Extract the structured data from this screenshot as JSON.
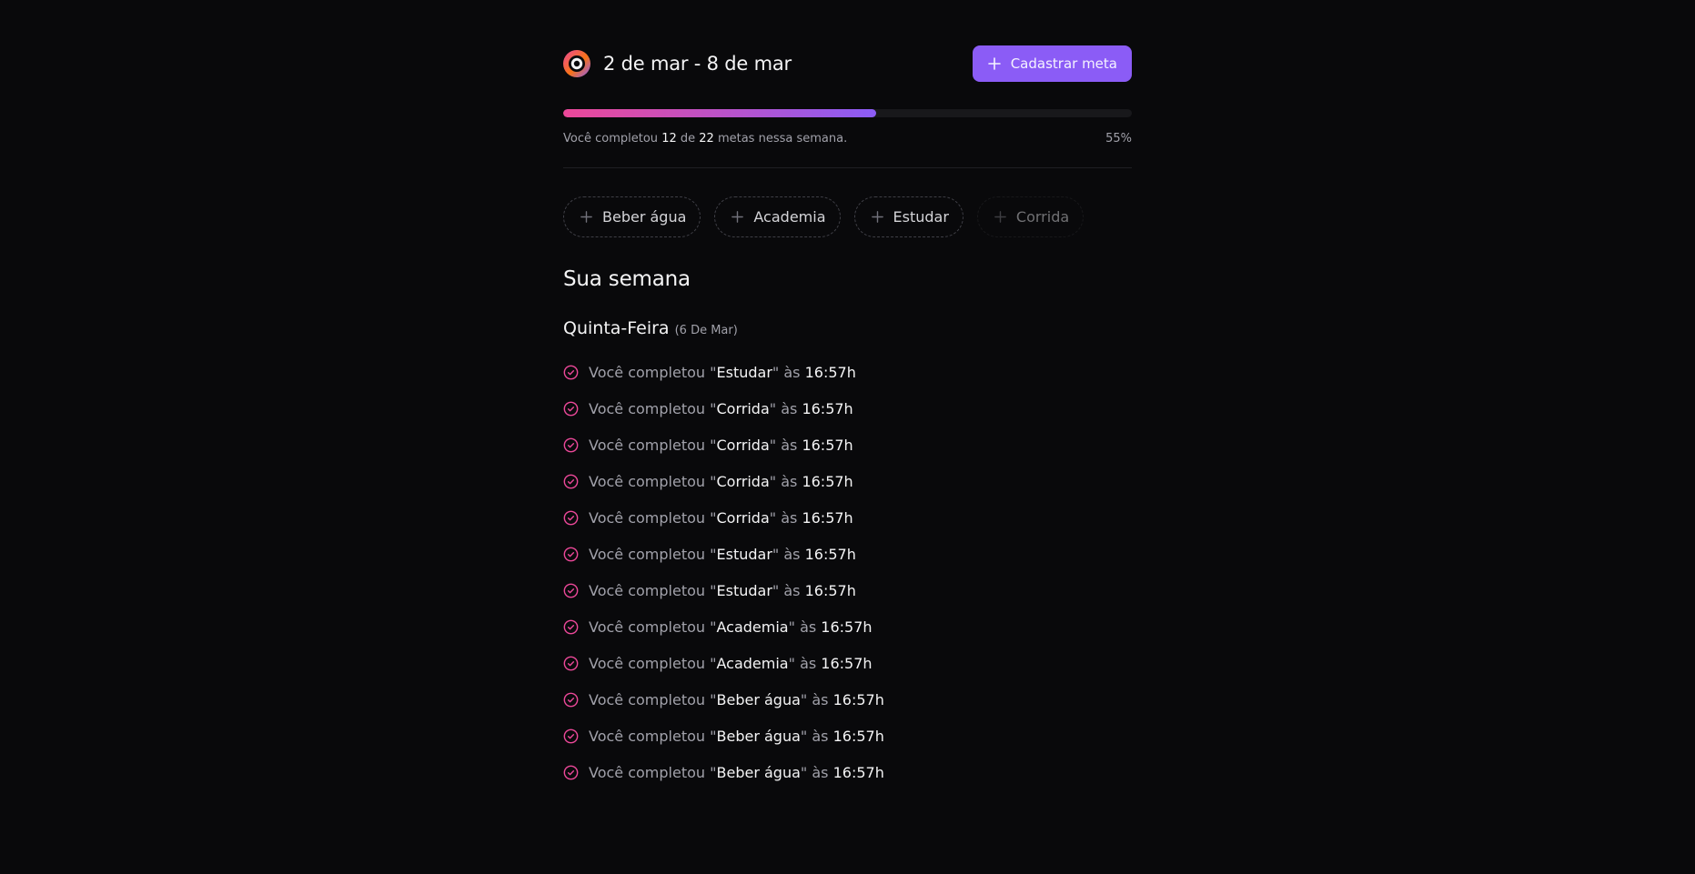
{
  "header": {
    "week_range": "2 de mar - 8 de mar",
    "create_button_label": "Cadastrar meta"
  },
  "progress": {
    "percent": 55,
    "completed": "12",
    "total": "22",
    "text_prefix": "Você completou",
    "text_middle": "de",
    "text_suffix": "metas nessa semana.",
    "percent_label": "55%"
  },
  "pending_goals": [
    {
      "label": "Beber água",
      "disabled": false
    },
    {
      "label": "Academia",
      "disabled": false
    },
    {
      "label": "Estudar",
      "disabled": false
    },
    {
      "label": "Corrida",
      "disabled": true
    }
  ],
  "summary": {
    "title": "Sua semana",
    "days": [
      {
        "weekday": "Quinta-Feira",
        "date": "(6 De Mar)",
        "completions": [
          {
            "prefix": "Você completou",
            "goal": "Estudar",
            "at": "às",
            "time": "16:57h"
          },
          {
            "prefix": "Você completou",
            "goal": "Corrida",
            "at": "às",
            "time": "16:57h"
          },
          {
            "prefix": "Você completou",
            "goal": "Corrida",
            "at": "às",
            "time": "16:57h"
          },
          {
            "prefix": "Você completou",
            "goal": "Corrida",
            "at": "às",
            "time": "16:57h"
          },
          {
            "prefix": "Você completou",
            "goal": "Corrida",
            "at": "às",
            "time": "16:57h"
          },
          {
            "prefix": "Você completou",
            "goal": "Estudar",
            "at": "às",
            "time": "16:57h"
          },
          {
            "prefix": "Você completou",
            "goal": "Estudar",
            "at": "às",
            "time": "16:57h"
          },
          {
            "prefix": "Você completou",
            "goal": "Academia",
            "at": "às",
            "time": "16:57h"
          },
          {
            "prefix": "Você completou",
            "goal": "Academia",
            "at": "às",
            "time": "16:57h"
          },
          {
            "prefix": "Você completou",
            "goal": "Beber água",
            "at": "às",
            "time": "16:57h"
          },
          {
            "prefix": "Você completou",
            "goal": "Beber água",
            "at": "às",
            "time": "16:57h"
          },
          {
            "prefix": "Você completou",
            "goal": "Beber água",
            "at": "às",
            "time": "16:57h"
          }
        ]
      }
    ]
  },
  "colors": {
    "background": "#09090b",
    "accent_violet": "#8b5cf6",
    "accent_pink": "#ec4899",
    "muted_text": "#a1a1aa"
  },
  "icons": {
    "logo": "in-orbit-logo-icon",
    "plus": "plus-icon",
    "completed": "circle-check-icon"
  }
}
